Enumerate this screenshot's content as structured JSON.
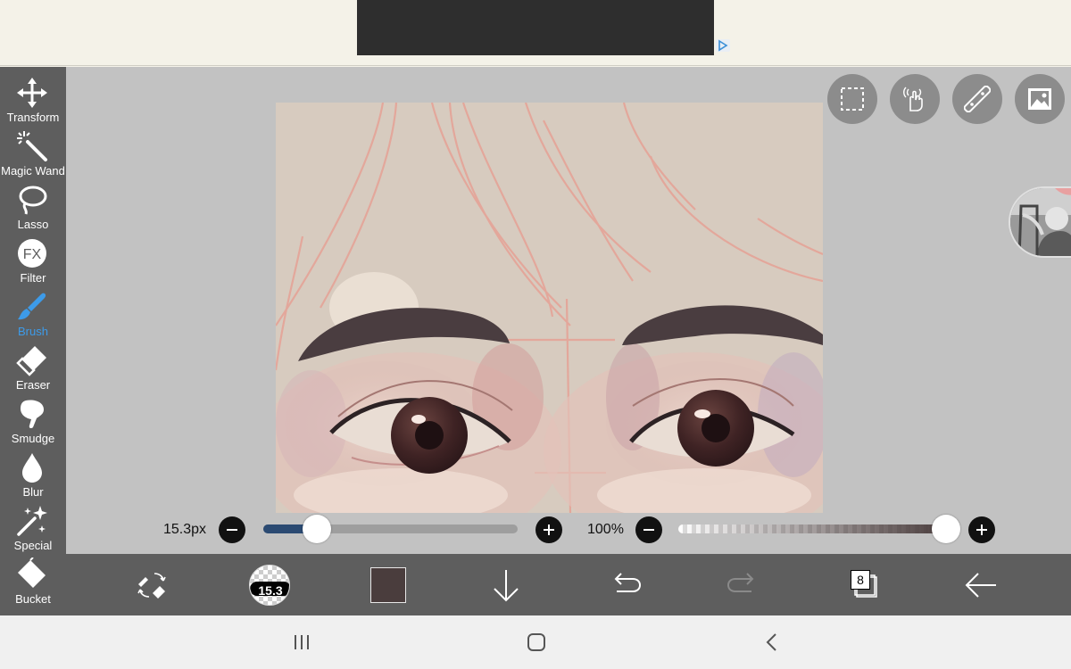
{
  "toolbar": {
    "tools": [
      {
        "label": "Transform",
        "icon": "move-arrows-icon"
      },
      {
        "label": "Magic Wand",
        "icon": "magic-wand-icon"
      },
      {
        "label": "Lasso",
        "icon": "lasso-icon"
      },
      {
        "label": "Filter",
        "icon": "fx-icon",
        "icon_text": "FX"
      },
      {
        "label": "Brush",
        "icon": "brush-icon",
        "active": true
      },
      {
        "label": "Eraser",
        "icon": "eraser-icon"
      },
      {
        "label": "Smudge",
        "icon": "smudge-icon"
      },
      {
        "label": "Blur",
        "icon": "drop-icon"
      },
      {
        "label": "Special",
        "icon": "sparkle-icon"
      },
      {
        "label": "Bucket",
        "icon": "bucket-icon"
      }
    ]
  },
  "top_buttons": [
    "selection-icon",
    "gesture-hand-icon",
    "ruler-icon",
    "image-icon"
  ],
  "brush_size": {
    "value_label": "15.3px",
    "fraction": 0.21
  },
  "opacity": {
    "value_label": "100%",
    "fraction": 1.0
  },
  "bottombar": {
    "brush_size_badge": "15.3",
    "current_color": "#4a3d3d",
    "layer_count": "8"
  },
  "colors": {
    "accent": "#3d9be9",
    "toolbar": "#5e5e5e",
    "workspace": "#c2c2c2",
    "slider_fill": "#2b4a72"
  }
}
